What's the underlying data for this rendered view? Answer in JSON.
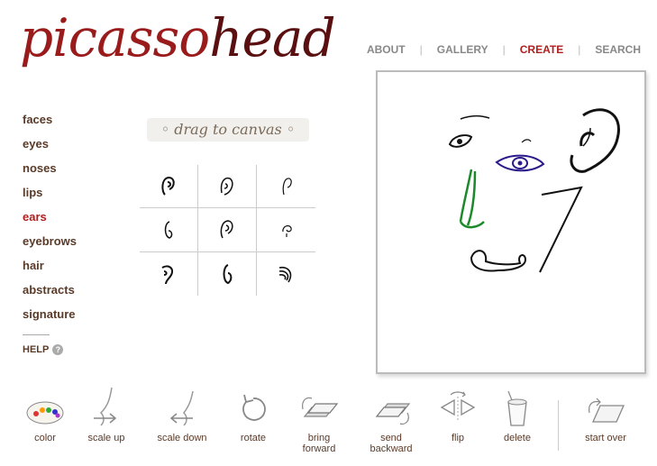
{
  "brand": {
    "part1": "picasso",
    "part2": "head"
  },
  "topnav": {
    "about": "ABOUT",
    "gallery": "GALLERY",
    "create": "CREATE",
    "search": "SEARCH"
  },
  "categories": [
    "faces",
    "eyes",
    "noses",
    "lips",
    "ears",
    "eyebrows",
    "hair",
    "abstracts",
    "signature"
  ],
  "active_category": "ears",
  "help": "HELP",
  "drag_label": "◦ drag to canvas ◦",
  "tools": {
    "color": "color",
    "scale_up": "scale up",
    "scale_down": "scale down",
    "rotate": "rotate",
    "bring_forward_1": "bring",
    "bring_forward_2": "forward",
    "send_backward_1": "send",
    "send_backward_2": "backward",
    "flip": "flip",
    "delete": "delete",
    "start_over": "start over"
  },
  "colors": {
    "active": "#b01e1e",
    "nose": "#1a8a2a",
    "eye_blue": "#2a1a8a"
  }
}
